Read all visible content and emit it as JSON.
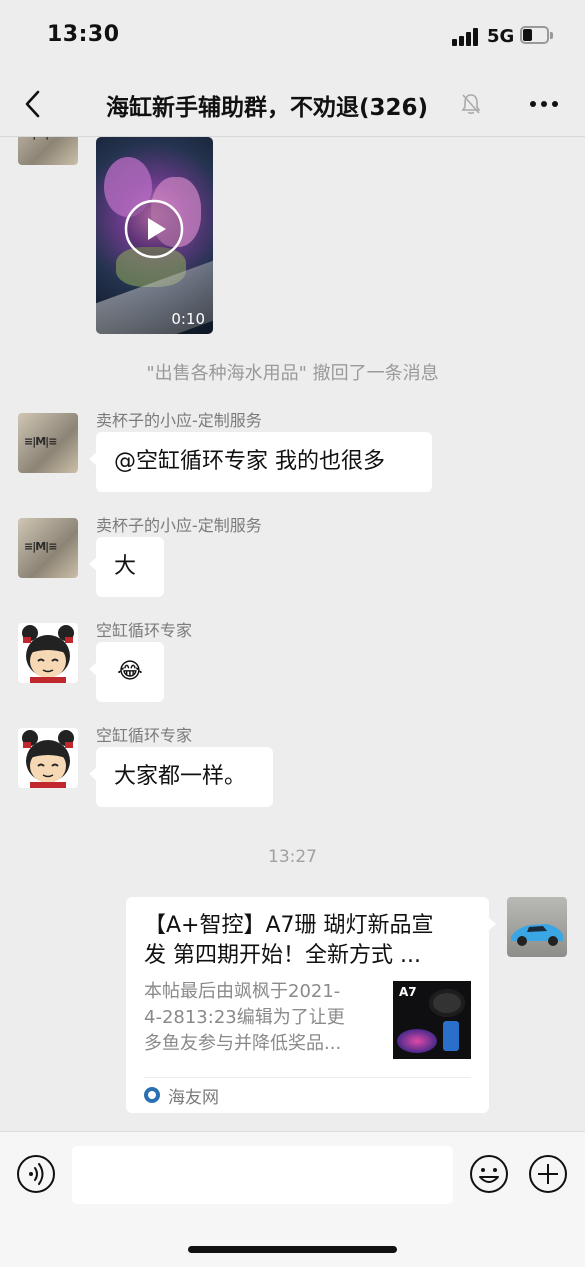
{
  "status_bar": {
    "time": "13:30",
    "network": "5G"
  },
  "nav": {
    "title": "海缸新手辅助群，不劝退(326)"
  },
  "video": {
    "duration": "0:10"
  },
  "system_message": "\"出售各种海水用品\" 撤回了一条消息",
  "messages": [
    {
      "sender": "卖杯子的小应-定制服务",
      "text": "@空缸循环专家 我的也很多",
      "avatar": "shop-avatar"
    },
    {
      "sender": "卖杯子的小应-定制服务",
      "text": "大",
      "avatar": "shop-avatar"
    },
    {
      "sender": "空缸循环专家",
      "text": "😂",
      "avatar": "cartoon-girl-avatar"
    },
    {
      "sender": "空缸循环专家",
      "text": "大家都一样。",
      "avatar": "cartoon-girl-avatar"
    }
  ],
  "timestamp": "13:27",
  "link_card": {
    "title_line1": "【A+智控】A7珊 瑚灯新品宣",
    "title_line2": "发  第四期开始！全新方式  ...",
    "desc_line1": "本帖最后由飒枫于2021-",
    "desc_line2": "4-2813:23编辑为了让更",
    "desc_line3": "多鱼友参与并降低奖品...",
    "thumb_label": "A7",
    "source": "海友网"
  },
  "colors": {
    "background": "#ededed",
    "bubble": "#ffffff",
    "muted_text": "#7b7b7b"
  }
}
